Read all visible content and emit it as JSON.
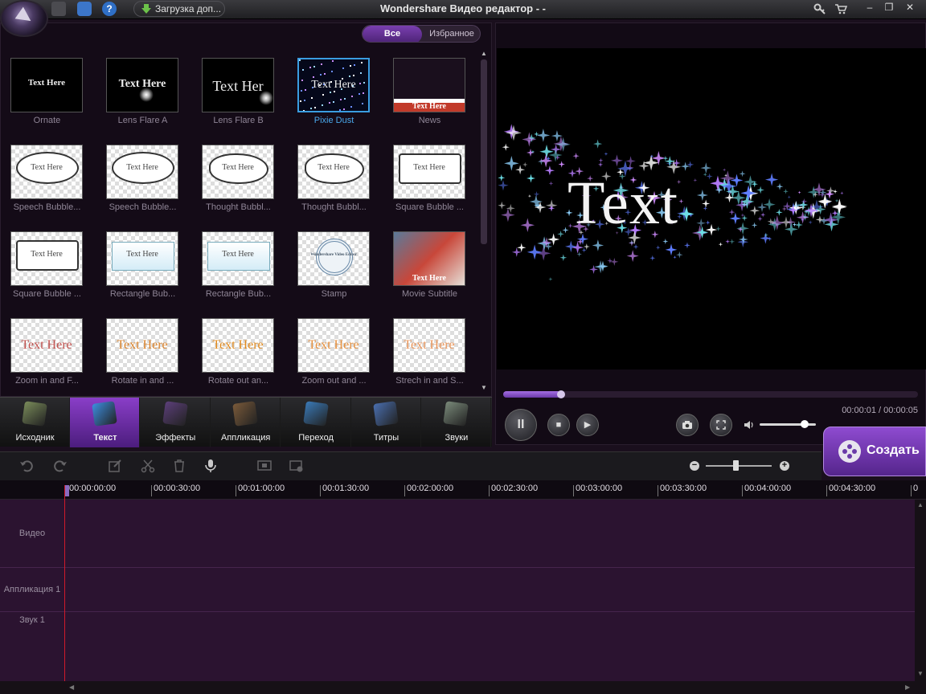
{
  "titlebar": {
    "title": "Wondershare Видео редактор - -",
    "download_label": "Загрузка доп...",
    "help_label": "?",
    "win_min": "–",
    "win_max": "❐",
    "win_close": "✕"
  },
  "library": {
    "filter_all": "Все",
    "filter_favorites": "Избранное",
    "tiles": [
      {
        "label": "Ornate",
        "preview_text": "Text Here",
        "style": "dark"
      },
      {
        "label": "Lens Flare A",
        "preview_text": "Text Here",
        "style": "dark"
      },
      {
        "label": "Lens Flare B",
        "preview_text": "Text Her",
        "style": "dark"
      },
      {
        "label": "Pixie Dust",
        "preview_text": "Text Here",
        "style": "dark",
        "selected": true
      },
      {
        "label": "News",
        "preview_text": "Text Here",
        "style": "news"
      },
      {
        "label": "Speech Bubble...",
        "preview_text": "Text Here",
        "style": "bubble"
      },
      {
        "label": "Speech Bubble...",
        "preview_text": "Text Here",
        "style": "bubble"
      },
      {
        "label": "Thought Bubbl...",
        "preview_text": "Text Here",
        "style": "thought"
      },
      {
        "label": "Thought Bubbl...",
        "preview_text": "Text Here",
        "style": "thought"
      },
      {
        "label": "Square Bubble ...",
        "preview_text": "Text Here",
        "style": "square"
      },
      {
        "label": "Square Bubble ...",
        "preview_text": "Text Here",
        "style": "square"
      },
      {
        "label": "Rectangle Bub...",
        "preview_text": "Text Here",
        "style": "rect"
      },
      {
        "label": "Rectangle Bub...",
        "preview_text": "Text Here",
        "style": "rect"
      },
      {
        "label": "Stamp",
        "preview_text": "Wondershare Video Editor",
        "style": "stamp"
      },
      {
        "label": "Movie Subtitle",
        "preview_text": "Text Here",
        "style": "photo"
      },
      {
        "label": "Zoom in and F...",
        "preview_text": "Text Here",
        "style": "anim",
        "color": "#c0504d"
      },
      {
        "label": "Rotate in and ...",
        "preview_text": "Text Here",
        "style": "anim",
        "color": "#d9822b"
      },
      {
        "label": "Rotate out an...",
        "preview_text": "Text Here",
        "style": "anim",
        "color": "#e08a1e"
      },
      {
        "label": "Zoom out and ...",
        "preview_text": "Text Here",
        "style": "anim",
        "color": "#e58f3c"
      },
      {
        "label": "Strech in and S...",
        "preview_text": "Text Here",
        "style": "anim",
        "color": "#e9955a"
      }
    ]
  },
  "categories": [
    {
      "label": "Исходник",
      "icon": "media-icon",
      "color": "#7a8c5a"
    },
    {
      "label": "Текст",
      "icon": "text-icon",
      "color": "#3d8fe0",
      "active": true
    },
    {
      "label": "Эффекты",
      "icon": "effects-icon",
      "color": "#5c3f7a"
    },
    {
      "label": "Аппликация",
      "icon": "overlay-icon",
      "color": "#7a5a3a"
    },
    {
      "label": "Переход",
      "icon": "transition-icon",
      "color": "#3a7ab8"
    },
    {
      "label": "Титры",
      "icon": "credits-icon",
      "color": "#4a6fb0"
    },
    {
      "label": "Звуки",
      "icon": "sound-icon",
      "color": "#7a8a7a"
    }
  ],
  "preview": {
    "text": "Text",
    "timecode": "00:00:01 / 00:00:05",
    "progress": 0.14,
    "volume": 0.8,
    "pause_label": "II",
    "stop_label": "■",
    "next_label": "▶"
  },
  "create_label": "Создать",
  "timeline": {
    "zoom": 0.45,
    "ruler": [
      "00:00:00:00",
      "00:00:30:00",
      "00:01:00:00",
      "00:01:30:00",
      "00:02:00:00",
      "00:02:30:00",
      "00:03:00:00",
      "00:03:30:00",
      "00:04:00:00",
      "00:04:30:00",
      "0"
    ],
    "tracks": [
      "Видео",
      "Аппликация 1",
      "Звук 1"
    ]
  },
  "colors": {
    "accent": "#7a3fb0",
    "selection": "#3a9de0",
    "playhead": "#d01a2a",
    "track_bg": "#2b1330"
  }
}
